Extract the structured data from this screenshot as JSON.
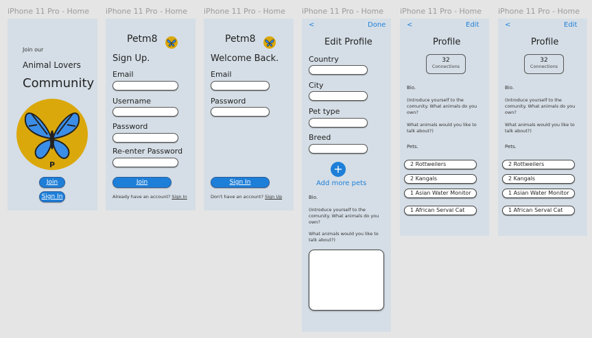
{
  "frames": [
    {
      "label": "iPhone 11 Pro - Home"
    },
    {
      "label": "iPhone 11 Pro - Home"
    },
    {
      "label": "iPhone 11 Pro - Home"
    },
    {
      "label": "iPhone 11 Pro - Home"
    },
    {
      "label": "iPhone 11 Pro - Home"
    },
    {
      "label": "iPhone 11 Pro - Home"
    }
  ],
  "welcome": {
    "join_our": "Join our",
    "animal_lovers": "Animal Lovers",
    "community": "Community",
    "logo_letter": "P",
    "join_button": "Join",
    "signin_button": "Sign In"
  },
  "signup": {
    "brand": "Petm8",
    "heading": "Sign Up.",
    "email_label": "Email",
    "username_label": "Username",
    "password_label": "Password",
    "reenter_label": "Re-enter Password",
    "join_button": "Join",
    "footer_text": "Already have an account?",
    "footer_link": "Sign In"
  },
  "signin": {
    "brand": "Petm8",
    "heading": "Welcome Back.",
    "email_label": "Email",
    "password_label": "Password",
    "signin_button": "Sign In",
    "footer_text": "Don't have an account?",
    "footer_link": "Sign Up"
  },
  "edit_profile": {
    "back": "<",
    "done": "Done",
    "title": "Edit Profile",
    "country_label": "Country",
    "city_label": "City",
    "pet_type_label": "Pet type",
    "breed_label": "Breed",
    "add_icon": "+",
    "add_more": "Add more pets",
    "bio_label": "Bio.",
    "bio_prompt1": "(Introduce yourself to the comunity. What animals do you own?",
    "bio_prompt2": "What animals would you like to talk about?)"
  },
  "profile": {
    "back": "<",
    "edit": "Edit",
    "title": "Profile",
    "connections_count": "32",
    "connections_label": "Connections",
    "bio_label": "Bio.",
    "bio_prompt1": "(Introduce yourself to the comunity. What animals do you own?",
    "bio_prompt2": "What animals would you like to talk about?)",
    "pets_label": "Pets.",
    "pets": [
      "2 Rottweilers",
      "2 Kangals",
      "1 Asian Water Monitor",
      "1 African Serval Cat"
    ]
  },
  "colors": {
    "canvas": "#e5e5e5",
    "frame": "#d5dee6",
    "accent": "#1e7fd8",
    "logo_yellow": "#dba80c",
    "butterfly_blue": "#3b8ee8"
  }
}
